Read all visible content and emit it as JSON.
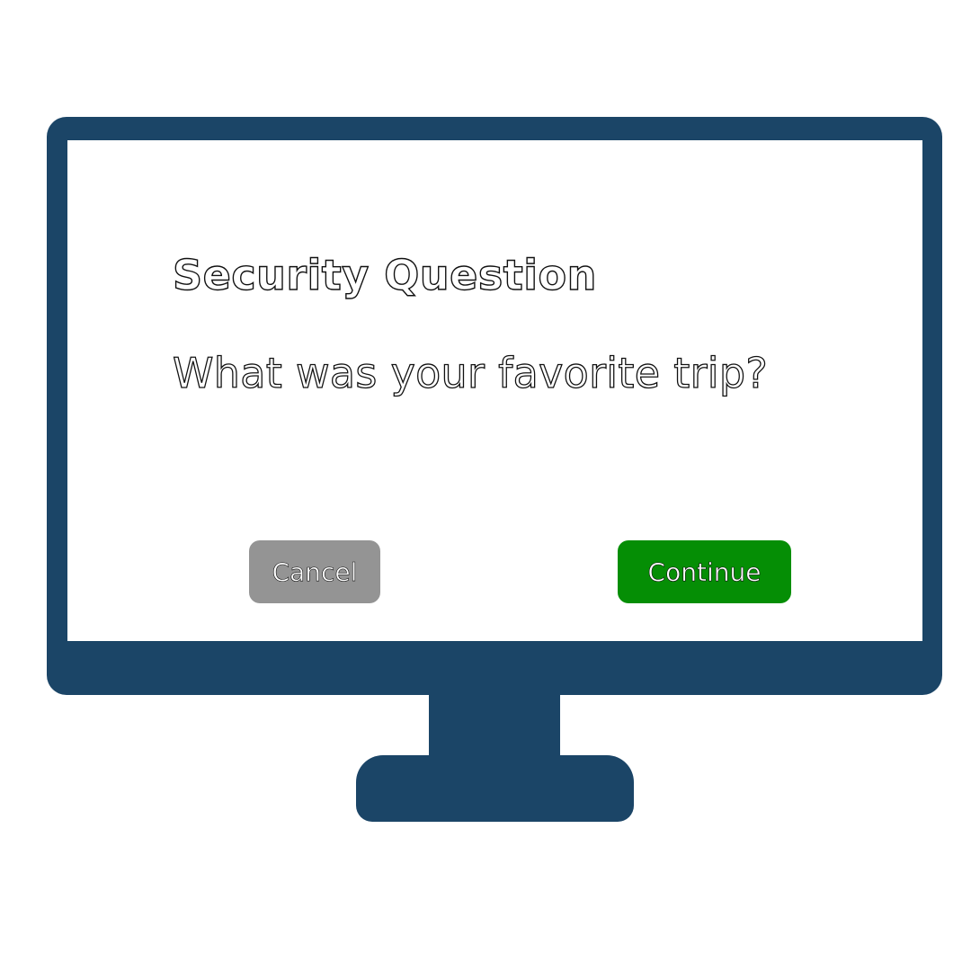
{
  "dialog": {
    "title": "Security Question",
    "question": "What was your favorite trip?"
  },
  "buttons": {
    "cancel_label": "Cancel",
    "continue_label": "Continue"
  },
  "colors": {
    "monitor": "#1b4567",
    "cancel": "#949494",
    "continue": "#058e05",
    "screen_background": "#ffffff"
  }
}
